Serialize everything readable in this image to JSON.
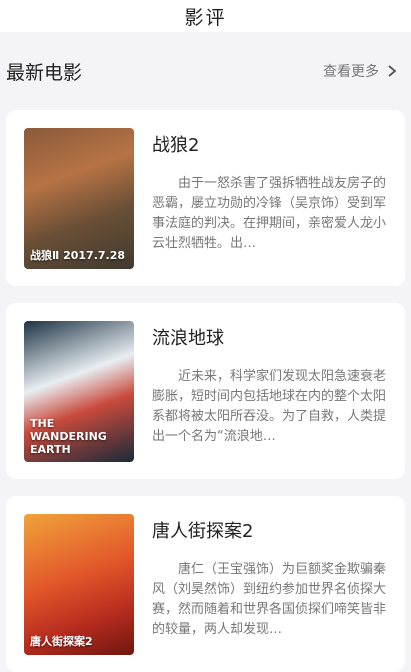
{
  "nav": {
    "title": "影评"
  },
  "section": {
    "title": "最新电影",
    "more_label": "查看更多"
  },
  "movies": [
    {
      "title": "战狼2",
      "poster_label": "战狼Ⅱ 2017.7.28",
      "description": "由于一怒杀害了强拆牺牲战友房子的恶霸，屡立功勋的冷锋（吴京饰）受到军事法庭的判决。在押期间，亲密爱人龙小云壮烈牺牲。出…"
    },
    {
      "title": "流浪地球",
      "poster_label": "THE WANDERING EARTH",
      "description": "近未来，科学家们发现太阳急速衰老膨胀，短时间内包括地球在内的整个太阳系都将被太阳所吞没。为了自救，人类提出一个名为“流浪地…"
    },
    {
      "title": "唐人街探案2",
      "poster_label": "唐人街探案2",
      "description": "唐仁（王宝强饰）为巨额奖金欺骗秦风（刘昊然饰）到纽约参加世界名侦探大赛，然而随着和世界各国侦探们啼笑皆非的较量，两人却发现…"
    }
  ]
}
